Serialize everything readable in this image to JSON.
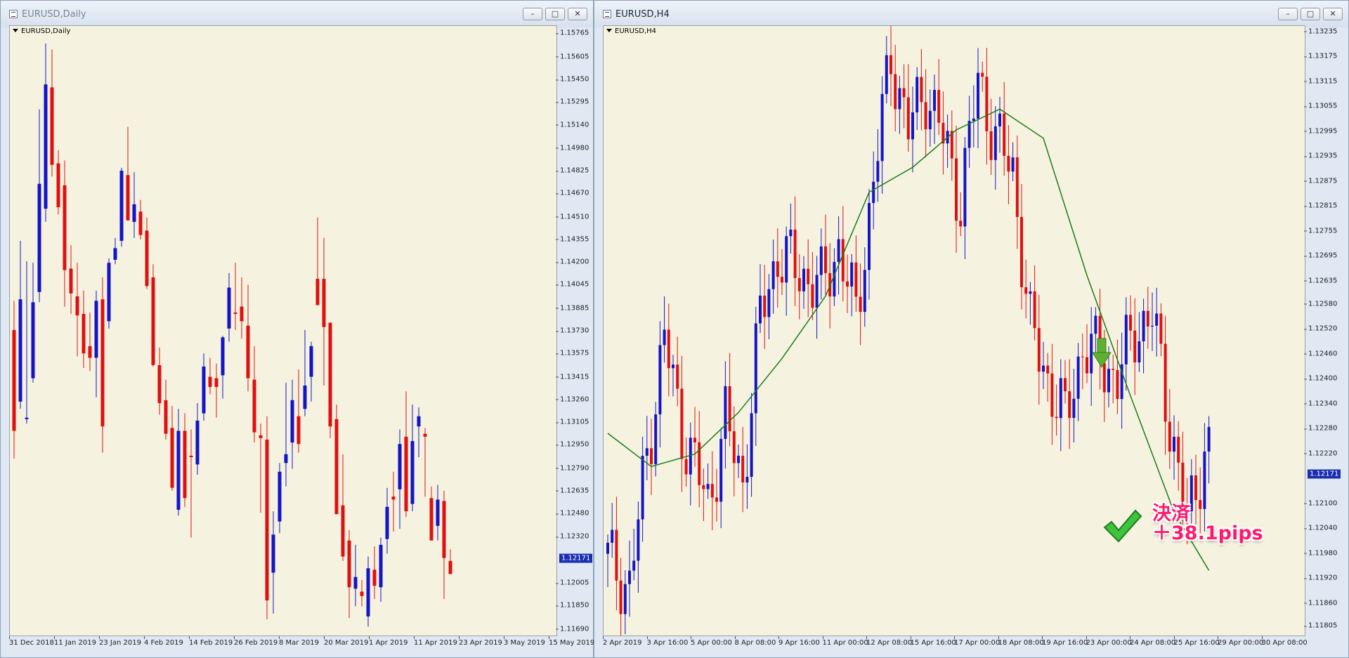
{
  "left": {
    "window_title": "EURUSD,Daily",
    "symbol_label": "EURUSD,Daily",
    "y_ticks": [
      "1.15765",
      "1.15605",
      "1.15450",
      "1.15295",
      "1.15140",
      "1.14980",
      "1.14825",
      "1.14670",
      "1.14510",
      "1.14355",
      "1.14200",
      "1.14045",
      "1.13885",
      "1.13730",
      "1.13575",
      "1.13415",
      "1.13260",
      "1.13105",
      "1.12950",
      "1.12790",
      "1.12635",
      "1.12480",
      "1.12320",
      "1.12005",
      "1.11850",
      "1.11690"
    ],
    "current_price": "1.12171",
    "x_ticks": [
      "31 Dec 2018",
      "11 Jan 2019",
      "23 Jan 2019",
      "4 Feb 2019",
      "14 Feb 2019",
      "26 Feb 2019",
      "8 Mar 2019",
      "20 Mar 2019",
      "1 Apr 2019",
      "11 Apr 2019",
      "23 Apr 2019",
      "3 May 2019",
      "15 May 2019"
    ]
  },
  "right": {
    "window_title": "EURUSD,H4",
    "symbol_label": "EURUSD,H4",
    "y_ticks": [
      "1.13235",
      "1.13175",
      "1.13115",
      "1.13055",
      "1.12995",
      "1.12935",
      "1.12875",
      "1.12815",
      "1.12755",
      "1.12695",
      "1.12635",
      "1.12580",
      "1.12520",
      "1.12460",
      "1.12400",
      "1.12340",
      "1.12280",
      "1.12220",
      "1.12100",
      "1.12040",
      "1.11980",
      "1.11920",
      "1.11860",
      "1.11805"
    ],
    "current_price": "1.12171",
    "x_ticks": [
      "2 Apr 2019",
      "3 Apr 16:00",
      "5 Apr 00:00",
      "8 Apr 08:00",
      "9 Apr 16:00",
      "11 Apr 00:00",
      "12 Apr 08:00",
      "15 Apr 16:00",
      "17 Apr 00:00",
      "18 Apr 08:00",
      "19 Apr 16:00",
      "23 Apr 00:00",
      "24 Apr 08:00",
      "25 Apr 16:00",
      "29 Apr 00:00",
      "30 Apr 08:00"
    ]
  },
  "annotation": {
    "line1": "決済",
    "line2": "＋38.1pips",
    "color": "#ff1a6c"
  },
  "colors": {
    "bull": "#1414c8",
    "bear": "#e01010",
    "ma": "#1b7a1b",
    "bg": "#f5f3df"
  },
  "icons": [
    "minimize-icon",
    "maximize-icon",
    "close-icon",
    "check-icon",
    "arrow-down-icon"
  ],
  "chart_data": [
    {
      "type": "candlestick",
      "title": "EURUSD,Daily",
      "xlabel": "",
      "ylabel": "",
      "ylim": [
        1.1164,
        1.1582
      ],
      "candles": [
        [
          1.1374,
          1.1394,
          1.1286,
          1.1305
        ],
        [
          1.1325,
          1.1435,
          1.132,
          1.1395
        ],
        [
          1.1313,
          1.1421,
          1.131,
          1.1314
        ],
        [
          1.1341,
          1.142,
          1.1338,
          1.1393
        ],
        [
          1.14,
          1.1525,
          1.1393,
          1.1474
        ],
        [
          1.1457,
          1.157,
          1.1448,
          1.1542
        ],
        [
          1.154,
          1.1566,
          1.1479,
          1.1487
        ],
        [
          1.1488,
          1.1497,
          1.1453,
          1.1458
        ],
        [
          1.1473,
          1.149,
          1.139,
          1.1415
        ],
        [
          1.1416,
          1.1432,
          1.1385,
          1.1399
        ],
        [
          1.1397,
          1.142,
          1.1356,
          1.1384
        ],
        [
          1.1385,
          1.1401,
          1.1348,
          1.1358
        ],
        [
          1.1363,
          1.1386,
          1.1346,
          1.1355
        ],
        [
          1.1355,
          1.1401,
          1.1328,
          1.1394
        ],
        [
          1.1395,
          1.141,
          1.129,
          1.1308
        ],
        [
          1.138,
          1.1423,
          1.1375,
          1.142
        ],
        [
          1.1422,
          1.1437,
          1.1419,
          1.143
        ],
        [
          1.1435,
          1.1485,
          1.1431,
          1.1483
        ],
        [
          1.148,
          1.1513,
          1.1452,
          1.1449
        ],
        [
          1.1448,
          1.1482,
          1.1437,
          1.146
        ],
        [
          1.1455,
          1.1463,
          1.1436,
          1.1439
        ],
        [
          1.1442,
          1.1451,
          1.1402,
          1.1404
        ],
        [
          1.141,
          1.1419,
          1.1349,
          1.135
        ],
        [
          1.135,
          1.1362,
          1.1316,
          1.1324
        ],
        [
          1.1326,
          1.134,
          1.1299,
          1.1303
        ],
        [
          1.1307,
          1.1322,
          1.1264,
          1.1266
        ],
        [
          1.1251,
          1.132,
          1.1247,
          1.1305
        ],
        [
          1.1305,
          1.1317,
          1.1253,
          1.1259
        ],
        [
          1.1288,
          1.1306,
          1.1232,
          1.1287
        ],
        [
          1.1282,
          1.1324,
          1.1275,
          1.1312
        ],
        [
          1.1317,
          1.1358,
          1.1312,
          1.1349
        ],
        [
          1.1342,
          1.1355,
          1.133,
          1.1335
        ],
        [
          1.1341,
          1.1351,
          1.1314,
          1.1335
        ],
        [
          1.1343,
          1.137,
          1.1327,
          1.1369
        ],
        [
          1.1375,
          1.1413,
          1.1366,
          1.1403
        ],
        [
          1.1386,
          1.142,
          1.1374,
          1.1385
        ],
        [
          1.139,
          1.141,
          1.1368,
          1.138
        ],
        [
          1.1377,
          1.1405,
          1.1332,
          1.1341
        ],
        [
          1.134,
          1.1363,
          1.1297,
          1.1304
        ],
        [
          1.1302,
          1.131,
          1.1249,
          1.13
        ],
        [
          1.1299,
          1.1315,
          1.1176,
          1.1189
        ],
        [
          1.1208,
          1.125,
          1.118,
          1.1234
        ],
        [
          1.1243,
          1.1283,
          1.1235,
          1.1277
        ],
        [
          1.1283,
          1.1338,
          1.1267,
          1.1289
        ],
        [
          1.1297,
          1.134,
          1.1279,
          1.1326
        ],
        [
          1.1315,
          1.1347,
          1.129,
          1.1296
        ],
        [
          1.132,
          1.1374,
          1.1315,
          1.1336
        ],
        [
          1.1342,
          1.1366,
          1.1325,
          1.1363
        ],
        [
          1.1409,
          1.1451,
          1.1392,
          1.1391
        ],
        [
          1.1409,
          1.1437,
          1.1336,
          1.1376
        ],
        [
          1.1379,
          1.1351,
          1.13,
          1.1308
        ],
        [
          1.1313,
          1.1323,
          1.1248,
          1.1248
        ],
        [
          1.1254,
          1.1289,
          1.1216,
          1.1219
        ],
        [
          1.123,
          1.1237,
          1.1177,
          1.1198
        ],
        [
          1.1197,
          1.1227,
          1.1185,
          1.1205
        ],
        [
          1.1195,
          1.1203,
          1.1185,
          1.1192
        ],
        [
          1.1178,
          1.1219,
          1.1171,
          1.1211
        ],
        [
          1.121,
          1.1226,
          1.119,
          1.1199
        ],
        [
          1.1198,
          1.1232,
          1.1188,
          1.1227
        ],
        [
          1.1231,
          1.1266,
          1.1221,
          1.1253
        ],
        [
          1.126,
          1.1277,
          1.1236,
          1.1258
        ],
        [
          1.1265,
          1.1306,
          1.1238,
          1.1296
        ],
        [
          1.1301,
          1.1332,
          1.1246,
          1.125
        ],
        [
          1.1255,
          1.1323,
          1.125,
          1.1298
        ],
        [
          1.1308,
          1.1321,
          1.1287,
          1.1315
        ],
        [
          1.1303,
          1.1307,
          1.126,
          1.1301
        ],
        [
          1.1259,
          1.1267,
          1.123,
          1.123
        ],
        [
          1.124,
          1.1268,
          1.123,
          1.1258
        ],
        [
          1.1257,
          1.1264,
          1.119,
          1.1218
        ],
        [
          1.1216,
          1.1224,
          1.121,
          1.1207
        ]
      ]
    },
    {
      "type": "candlestick",
      "title": "EURUSD,H4",
      "xlabel": "",
      "ylabel": "",
      "ylim": [
        1.1178,
        1.1325
      ],
      "ma_line": [
        [
          0,
          1.1227
        ],
        [
          10,
          1.1219
        ],
        [
          20,
          1.1222
        ],
        [
          30,
          1.1232
        ],
        [
          40,
          1.1245
        ],
        [
          50,
          1.126
        ],
        [
          60,
          1.1285
        ],
        [
          70,
          1.1291
        ],
        [
          80,
          1.13
        ],
        [
          90,
          1.1305
        ],
        [
          100,
          1.1298
        ],
        [
          110,
          1.1265
        ],
        [
          120,
          1.1236
        ],
        [
          130,
          1.1208
        ],
        [
          138,
          1.1194
        ]
      ],
      "candle_count": 139
    }
  ]
}
